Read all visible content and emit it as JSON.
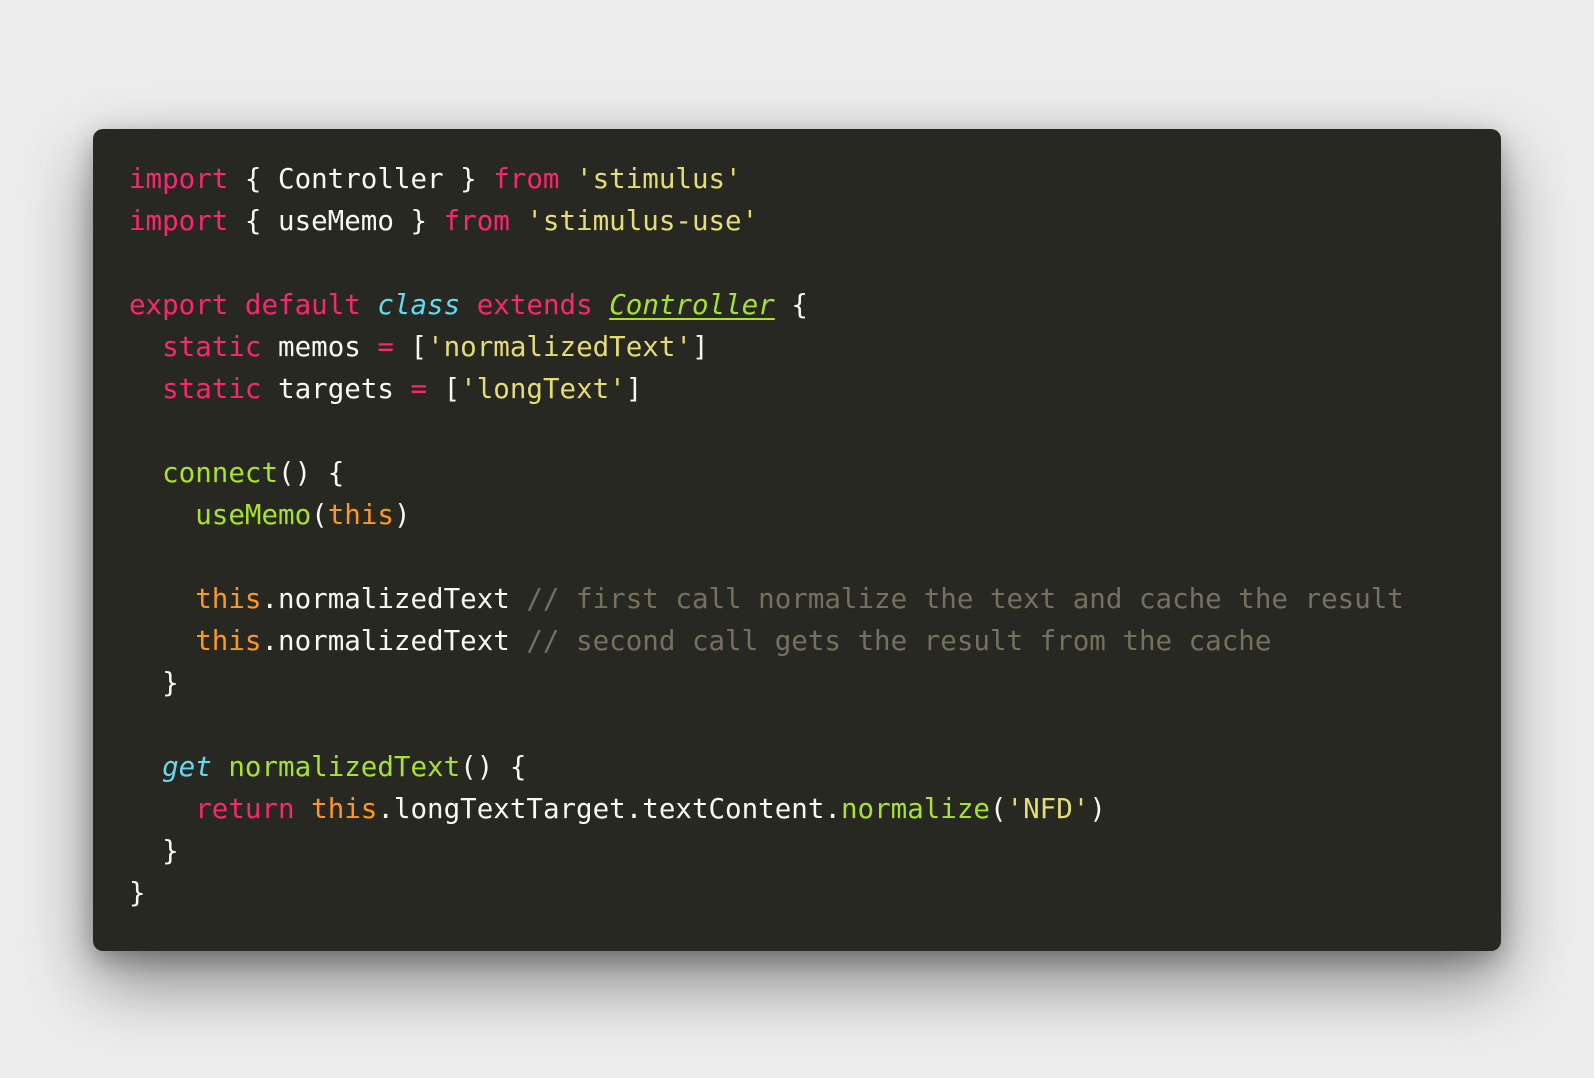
{
  "colors": {
    "page_background": "#ededed",
    "editor_background": "#272822",
    "plain": "#f8f8f2",
    "keyword": "#f92672",
    "string": "#e6db74",
    "storage_type": "#66d9ef",
    "function": "#a6e22e",
    "this": "#fd971f",
    "comment": "#75715e"
  },
  "code": {
    "language": "javascript",
    "lines": [
      [
        {
          "text": "import",
          "kind": "keyword"
        },
        {
          "text": " { Controller } ",
          "kind": "plain"
        },
        {
          "text": "from",
          "kind": "keyword"
        },
        {
          "text": " ",
          "kind": "plain"
        },
        {
          "text": "'stimulus'",
          "kind": "string"
        }
      ],
      [
        {
          "text": "import",
          "kind": "keyword"
        },
        {
          "text": " { useMemo } ",
          "kind": "plain"
        },
        {
          "text": "from",
          "kind": "keyword"
        },
        {
          "text": " ",
          "kind": "plain"
        },
        {
          "text": "'stimulus-use'",
          "kind": "string"
        }
      ],
      [],
      [
        {
          "text": "export",
          "kind": "keyword"
        },
        {
          "text": " ",
          "kind": "plain"
        },
        {
          "text": "default",
          "kind": "keyword"
        },
        {
          "text": " ",
          "kind": "plain"
        },
        {
          "text": "class",
          "kind": "storage_type",
          "italic": true
        },
        {
          "text": " ",
          "kind": "plain"
        },
        {
          "text": "extends",
          "kind": "keyword"
        },
        {
          "text": " ",
          "kind": "plain"
        },
        {
          "text": "Controller",
          "kind": "function",
          "italic": true,
          "underline": true
        },
        {
          "text": " {",
          "kind": "plain"
        }
      ],
      [
        {
          "text": "  ",
          "kind": "plain"
        },
        {
          "text": "static",
          "kind": "keyword"
        },
        {
          "text": " memos ",
          "kind": "plain"
        },
        {
          "text": "=",
          "kind": "keyword"
        },
        {
          "text": " [",
          "kind": "plain"
        },
        {
          "text": "'normalizedText'",
          "kind": "string"
        },
        {
          "text": "]",
          "kind": "plain"
        }
      ],
      [
        {
          "text": "  ",
          "kind": "plain"
        },
        {
          "text": "static",
          "kind": "keyword"
        },
        {
          "text": " targets ",
          "kind": "plain"
        },
        {
          "text": "=",
          "kind": "keyword"
        },
        {
          "text": " [",
          "kind": "plain"
        },
        {
          "text": "'longText'",
          "kind": "string"
        },
        {
          "text": "]",
          "kind": "plain"
        }
      ],
      [],
      [
        {
          "text": "  ",
          "kind": "plain"
        },
        {
          "text": "connect",
          "kind": "function"
        },
        {
          "text": "() {",
          "kind": "plain"
        }
      ],
      [
        {
          "text": "    ",
          "kind": "plain"
        },
        {
          "text": "useMemo",
          "kind": "function"
        },
        {
          "text": "(",
          "kind": "plain"
        },
        {
          "text": "this",
          "kind": "this"
        },
        {
          "text": ")",
          "kind": "plain"
        }
      ],
      [],
      [
        {
          "text": "    ",
          "kind": "plain"
        },
        {
          "text": "this",
          "kind": "this"
        },
        {
          "text": ".normalizedText ",
          "kind": "plain"
        },
        {
          "text": "// first call normalize the text and cache the result",
          "kind": "comment"
        }
      ],
      [
        {
          "text": "    ",
          "kind": "plain"
        },
        {
          "text": "this",
          "kind": "this"
        },
        {
          "text": ".normalizedText ",
          "kind": "plain"
        },
        {
          "text": "// second call gets the result from the cache",
          "kind": "comment"
        }
      ],
      [
        {
          "text": "  }",
          "kind": "plain"
        }
      ],
      [],
      [
        {
          "text": "  ",
          "kind": "plain"
        },
        {
          "text": "get",
          "kind": "storage_type",
          "italic": true
        },
        {
          "text": " ",
          "kind": "plain"
        },
        {
          "text": "normalizedText",
          "kind": "function"
        },
        {
          "text": "() {",
          "kind": "plain"
        }
      ],
      [
        {
          "text": "    ",
          "kind": "plain"
        },
        {
          "text": "return",
          "kind": "keyword"
        },
        {
          "text": " ",
          "kind": "plain"
        },
        {
          "text": "this",
          "kind": "this"
        },
        {
          "text": ".longTextTarget.textContent.",
          "kind": "plain"
        },
        {
          "text": "normalize",
          "kind": "function"
        },
        {
          "text": "(",
          "kind": "plain"
        },
        {
          "text": "'NFD'",
          "kind": "string"
        },
        {
          "text": ")",
          "kind": "plain"
        }
      ],
      [
        {
          "text": "  }",
          "kind": "plain"
        }
      ],
      [
        {
          "text": "}",
          "kind": "plain"
        }
      ]
    ]
  }
}
